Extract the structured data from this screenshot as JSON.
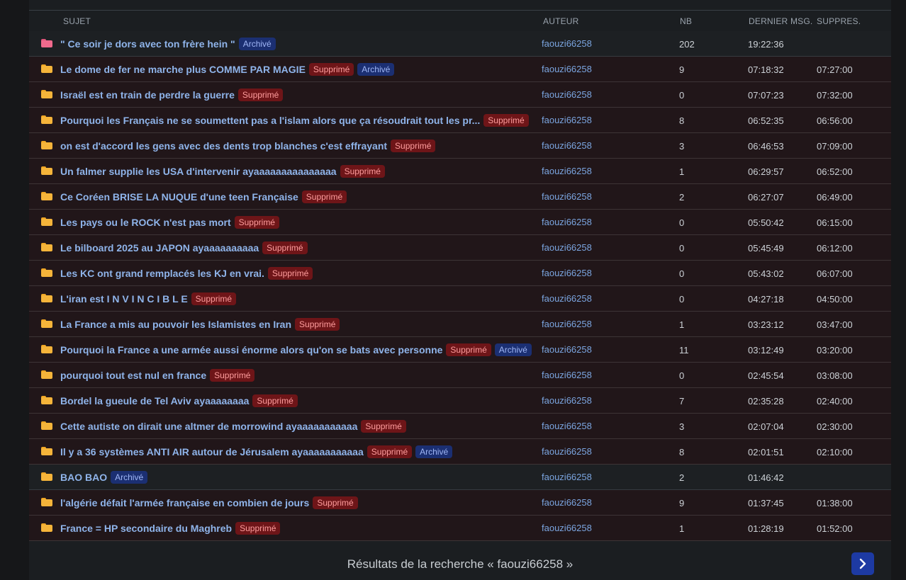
{
  "header": {
    "subject": "SUJET",
    "author": "AUTEUR",
    "nb": "NB",
    "last_msg": "DERNIER MSG.",
    "deleted": "SUPPRES."
  },
  "rows": [
    {
      "title": "\" Ce soir je dors avec ton frère hein \"",
      "badges": [
        "Archivé"
      ],
      "author": "faouzi66258",
      "nb": "202",
      "last": "19:22:36",
      "supp": "",
      "icon": "pink-folder-icon",
      "deleted": false
    },
    {
      "title": "Le dome de fer ne marche plus COMME PAR MAGIE",
      "badges": [
        "Supprimé",
        "Archivé"
      ],
      "author": "faouzi66258",
      "nb": "9",
      "last": "07:18:32",
      "supp": "07:27:00",
      "icon": "folder-icon",
      "deleted": true
    },
    {
      "title": "Israël est en train de perdre la guerre",
      "badges": [
        "Supprimé"
      ],
      "author": "faouzi66258",
      "nb": "0",
      "last": "07:07:23",
      "supp": "07:32:00",
      "icon": "folder-icon",
      "deleted": true
    },
    {
      "title": "Pourquoi les Français ne se soumettent pas a l'islam alors que ça résoudrait tout les pr...",
      "badges": [
        "Supprimé"
      ],
      "author": "faouzi66258",
      "nb": "8",
      "last": "06:52:35",
      "supp": "06:56:00",
      "icon": "folder-icon",
      "deleted": true
    },
    {
      "title": "on est d'accord les gens avec des dents trop blanches c'est effrayant",
      "badges": [
        "Supprimé"
      ],
      "author": "faouzi66258",
      "nb": "3",
      "last": "06:46:53",
      "supp": "07:09:00",
      "icon": "folder-icon",
      "deleted": true
    },
    {
      "title": "Un falmer supplie les USA d'intervenir ayaaaaaaaaaaaaaaa",
      "badges": [
        "Supprimé"
      ],
      "author": "faouzi66258",
      "nb": "1",
      "last": "06:29:57",
      "supp": "06:52:00",
      "icon": "folder-icon",
      "deleted": true
    },
    {
      "title": "Ce Coréen BRISE LA NUQUE d'une teen Française",
      "badges": [
        "Supprimé"
      ],
      "author": "faouzi66258",
      "nb": "2",
      "last": "06:27:07",
      "supp": "06:49:00",
      "icon": "folder-icon",
      "deleted": true
    },
    {
      "title": "Les pays ou le ROCK n'est pas mort",
      "badges": [
        "Supprimé"
      ],
      "author": "faouzi66258",
      "nb": "0",
      "last": "05:50:42",
      "supp": "06:15:00",
      "icon": "folder-icon",
      "deleted": true
    },
    {
      "title": "Le bilboard 2025 au JAPON ayaaaaaaaaaa",
      "badges": [
        "Supprimé"
      ],
      "author": "faouzi66258",
      "nb": "0",
      "last": "05:45:49",
      "supp": "06:12:00",
      "icon": "folder-icon",
      "deleted": true
    },
    {
      "title": "Les KC ont grand remplacés les KJ en vrai.",
      "badges": [
        "Supprimé"
      ],
      "author": "faouzi66258",
      "nb": "0",
      "last": "05:43:02",
      "supp": "06:07:00",
      "icon": "folder-icon",
      "deleted": true
    },
    {
      "title": "L'iran est I N V I N C I B L E",
      "badges": [
        "Supprimé"
      ],
      "author": "faouzi66258",
      "nb": "0",
      "last": "04:27:18",
      "supp": "04:50:00",
      "icon": "folder-icon",
      "deleted": true
    },
    {
      "title": "La France a mis au pouvoir les Islamistes en Iran",
      "badges": [
        "Supprimé"
      ],
      "author": "faouzi66258",
      "nb": "1",
      "last": "03:23:12",
      "supp": "03:47:00",
      "icon": "folder-icon",
      "deleted": true
    },
    {
      "title": "Pourquoi la France a une armée aussi énorme alors qu'on se bats avec personne",
      "badges": [
        "Supprimé",
        "Archivé"
      ],
      "author": "faouzi66258",
      "nb": "11",
      "last": "03:12:49",
      "supp": "03:20:00",
      "icon": "folder-icon",
      "deleted": true
    },
    {
      "title": "pourquoi tout est nul en france",
      "badges": [
        "Supprimé"
      ],
      "author": "faouzi66258",
      "nb": "0",
      "last": "02:45:54",
      "supp": "03:08:00",
      "icon": "folder-icon",
      "deleted": true
    },
    {
      "title": "Bordel la gueule de Tel Aviv ayaaaaaaaa",
      "badges": [
        "Supprimé"
      ],
      "author": "faouzi66258",
      "nb": "7",
      "last": "02:35:28",
      "supp": "02:40:00",
      "icon": "folder-icon",
      "deleted": true
    },
    {
      "title": "Cette autiste on dirait une altmer de morrowind ayaaaaaaaaaaa",
      "badges": [
        "Supprimé"
      ],
      "author": "faouzi66258",
      "nb": "3",
      "last": "02:07:04",
      "supp": "02:30:00",
      "icon": "folder-icon",
      "deleted": true
    },
    {
      "title": "Il y a 36 systèmes ANTI AIR autour de Jérusalem ayaaaaaaaaaaa",
      "badges": [
        "Supprimé",
        "Archivé"
      ],
      "author": "faouzi66258",
      "nb": "8",
      "last": "02:01:51",
      "supp": "02:10:00",
      "icon": "folder-icon",
      "deleted": true
    },
    {
      "title": "BAO BAO",
      "badges": [
        "Archivé"
      ],
      "author": "faouzi66258",
      "nb": "2",
      "last": "01:46:42",
      "supp": "",
      "icon": "folder-icon",
      "deleted": false
    },
    {
      "title": "l'algérie défait l'armée française en combien de jours",
      "badges": [
        "Supprimé"
      ],
      "author": "faouzi66258",
      "nb": "9",
      "last": "01:37:45",
      "supp": "01:38:00",
      "icon": "folder-icon",
      "deleted": true
    },
    {
      "title": "France = HP secondaire du Maghreb",
      "badges": [
        "Supprimé"
      ],
      "author": "faouzi66258",
      "nb": "1",
      "last": "01:28:19",
      "supp": "01:52:00",
      "icon": "folder-icon",
      "deleted": true
    }
  ],
  "footer": {
    "search_text": "Résultats de la recherche « faouzi66258 »",
    "next_icon": "chevron-right-icon"
  },
  "colors": {
    "deleted_row_bg": "#211619",
    "normal_row_bg": "#1d2023",
    "badge_deleted": "#6e1518",
    "badge_archived": "#1b2f72",
    "link": "#8fb4ea",
    "next_button": "#1d3aa3"
  }
}
